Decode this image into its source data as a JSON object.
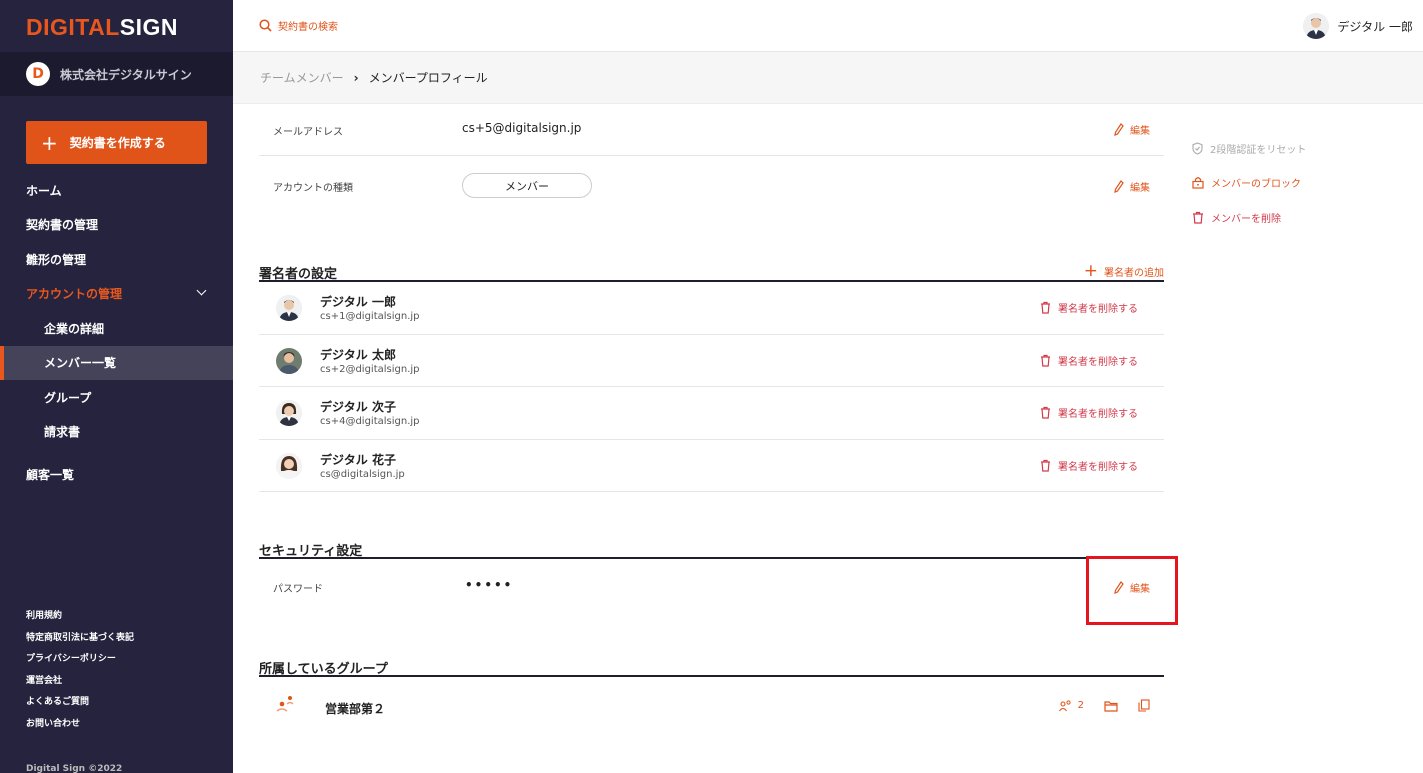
{
  "brand": {
    "logo_part1": "DIGITAL",
    "logo_part2": "SIGN",
    "accent": "#e0541a"
  },
  "company": {
    "mark": "D",
    "name": "株式会社デジタルサイン"
  },
  "sidebar": {
    "create_button": "契約書を作成する",
    "items": [
      {
        "label": "ホーム"
      },
      {
        "label": "契約書の管理"
      },
      {
        "label": "雛形の管理"
      },
      {
        "label": "アカウントの管理"
      },
      {
        "label": "企業の詳細"
      },
      {
        "label": "メンバー一覧"
      },
      {
        "label": "グループ"
      },
      {
        "label": "請求書"
      },
      {
        "label": "顧客一覧"
      }
    ],
    "footer_links": [
      "利用規約",
      "特定商取引法に基づく表記",
      "プライバシーポリシー",
      "運営会社",
      "よくあるご質問",
      "お問い合わせ"
    ],
    "copyright": "Digital Sign ©2022"
  },
  "header": {
    "search_label": "契約書の検索",
    "user_name": "デジタル 一郎"
  },
  "breadcrumb": {
    "parent": "チームメンバー",
    "separator": "›",
    "current": "メンバープロフィール"
  },
  "profile": {
    "email_label": "メールアドレス",
    "email_value": "cs+5@digitalsign.jp",
    "account_type_label": "アカウントの種類",
    "account_type_value": "メンバー",
    "edit_label": "編集"
  },
  "signers": {
    "title": "署名者の設定",
    "add_label": "署名者の追加",
    "remove_label": "署名者を削除する",
    "items": [
      {
        "name": "デジタル 一郎",
        "email": "cs+1@digitalsign.jp"
      },
      {
        "name": "デジタル 太郎",
        "email": "cs+2@digitalsign.jp"
      },
      {
        "name": "デジタル 次子",
        "email": "cs+4@digitalsign.jp"
      },
      {
        "name": "デジタル 花子",
        "email": "cs@digitalsign.jp"
      }
    ]
  },
  "security": {
    "title": "セキュリティ設定",
    "password_label": "パスワード",
    "password_value": "•••••",
    "edit_label": "編集"
  },
  "groups": {
    "title": "所属しているグループ",
    "items": [
      {
        "name": "営業部第２",
        "member_count": "2"
      }
    ]
  },
  "side_actions": {
    "reset_2fa": "2段階認証をリセット",
    "block_member": "メンバーのブロック",
    "delete_member": "メンバーを削除"
  }
}
